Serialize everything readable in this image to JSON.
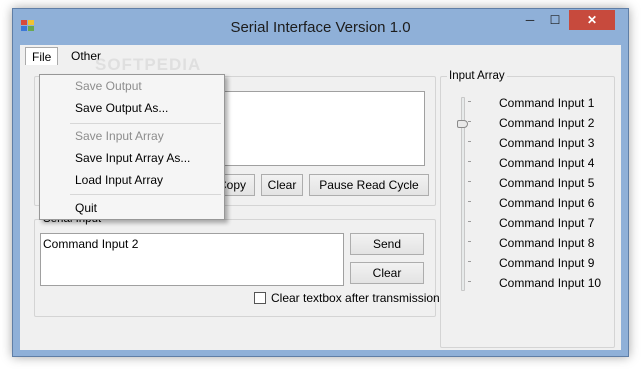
{
  "window": {
    "title": "Serial Interface Version 1.0",
    "min_label": "─",
    "max_label": "☐",
    "close_label": "✕"
  },
  "menu": {
    "file": "File",
    "other": "Other",
    "file_items": {
      "save_output": "Save Output",
      "save_output_as": "Save Output As...",
      "save_input_array": "Save Input Array",
      "save_input_array_as": "Save Input Array As...",
      "load_input_array": "Load Input Array",
      "quit": "Quit"
    }
  },
  "output": {
    "copy_label": "Copy",
    "clear_label": "Clear",
    "pause_label": "Pause Read Cycle"
  },
  "serial_input": {
    "legend": "Serial Input",
    "value": "Command Input 2",
    "send_label": "Send",
    "clear_label": "Clear",
    "clear_after_label": "Clear textbox after transmission",
    "clear_after_checked": false
  },
  "input_array": {
    "legend": "Input Array",
    "selected_index": 2,
    "commands": [
      "Command Input 1",
      "Command Input 2",
      "Command Input 3",
      "Command Input 4",
      "Command Input 5",
      "Command Input 6",
      "Command Input 7",
      "Command Input 8",
      "Command Input 9",
      "Command Input 10"
    ]
  },
  "watermark": "SOFTPEDIA",
  "colors": {
    "close_button": "#c74a3d",
    "title_bar": "#8fb0d8"
  }
}
